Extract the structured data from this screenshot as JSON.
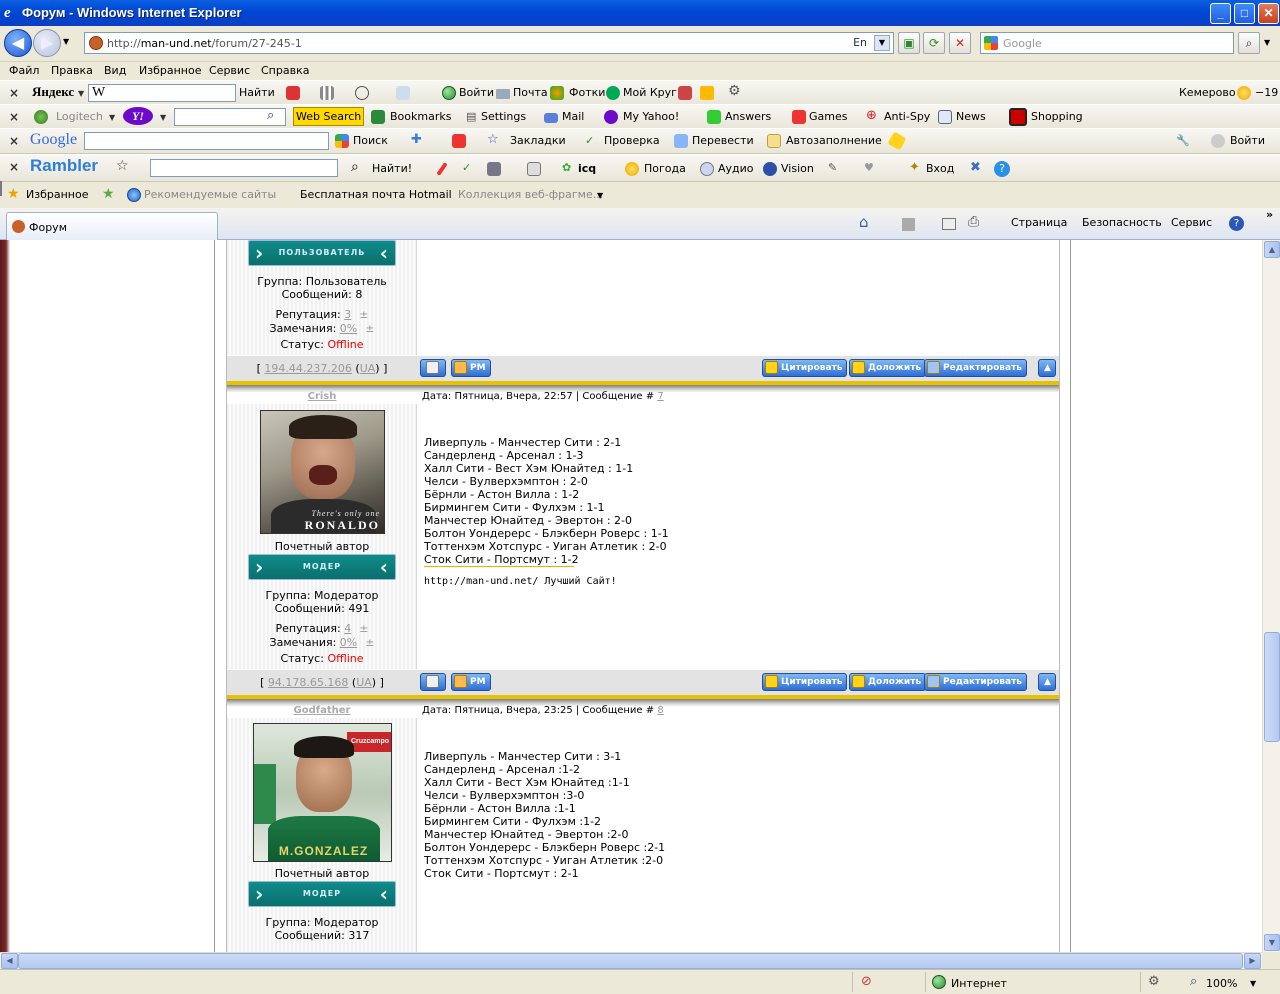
{
  "window": {
    "title": "Форум - Windows Internet Explorer",
    "minimize": "_",
    "maximize": "□",
    "close": "✕"
  },
  "address": {
    "url_prefix": "http://",
    "url_host": "man-und.net",
    "url_path": "/forum/27-245-1",
    "lang": "En",
    "search_placeholder": "Google"
  },
  "menu": [
    "Файл",
    "Правка",
    "Вид",
    "Избранное",
    "Сервис",
    "Справка"
  ],
  "yandex_bar": {
    "logo": "Яндекс",
    "input_value": "W",
    "find": "Найти",
    "items": [
      "Войти",
      "Почта",
      "Фотки",
      "Мой Круг"
    ],
    "city": "Кемерово",
    "temp": "−19"
  },
  "yahoo_bar": {
    "logitech": "Logitech",
    "yahoo_logo": "Y!",
    "web_search": "Web Search",
    "items": [
      "Bookmarks",
      "Settings",
      "Mail",
      "My Yahoo!",
      "Answers",
      "Games",
      "Anti-Spy",
      "News",
      "Shopping"
    ]
  },
  "google_bar": {
    "logo": "Google",
    "items": [
      "Поиск",
      "Закладки",
      "Проверка",
      "Перевести",
      "Автозаполнение"
    ],
    "login": "Войти"
  },
  "rambler_bar": {
    "logo": "Rambler",
    "find": "Найти!",
    "items": [
      "icq",
      "Погода",
      "Аудио",
      "Vision",
      "Вход"
    ]
  },
  "favorites_bar": {
    "favorites": "Избранное",
    "items": [
      "Рекомендуемые сайты",
      "Бесплатная почта Hotmail",
      "Коллекция веб-фрагме..."
    ]
  },
  "tab": {
    "title": "Форум"
  },
  "command_bar": [
    "Страница",
    "Безопасность",
    "Сервис"
  ],
  "posts": [
    {
      "nick": "",
      "badge": "ПОЛЬЗОВАТЕЛЬ",
      "group": "Группа: Пользователь",
      "messages": "Сообщений: 8",
      "reputation_label": "Репутация:",
      "reputation": "3",
      "remarks_label": "Замечания:",
      "remarks": "0%",
      "pm": "±",
      "status_label": "Статус:",
      "status": "Offline",
      "ip": "194.44.237.206",
      "country": "UA"
    },
    {
      "nick": "Crish",
      "date": "Дата: Пятница, Вчера, 22:57 | Сообщение #",
      "msg_no": "7",
      "title": "Почетный автор",
      "badge": "МОДЕР",
      "group": "Группа: Модератор",
      "messages": "Сообщений: 491",
      "reputation_label": "Репутация:",
      "reputation": "4",
      "remarks_label": "Замечания:",
      "remarks": "0%",
      "pm": "±",
      "status_label": "Статус:",
      "status": "Offline",
      "ip": "94.178.65.168",
      "country": "UA",
      "avatar_text": "There's only one",
      "avatar_name": "RONALDO",
      "lines": [
        "Ливерпуль - Манчестер Сити : 2-1",
        "Сандерленд - Арсенал : 1-3",
        "Халл Сити - Вест Хэм Юнайтед : 1-1",
        "Челси - Вулверхэмптон : 2-0",
        "Бёрнли - Астон Вилла : 1-2",
        "Бирмингем Сити - Фулхэм : 1-1",
        "Манчестер Юнайтед - Эвертон : 2-0",
        "Болтон Уондерерс - Блэкберн Роверс : 1-1",
        "Тоттенхэм Хотспурс - Уиган Атлетик : 2-0",
        "Сток Сити - Портсмут : 1-2"
      ],
      "signature": "http://man-und.net/ Лучший Сайт!"
    },
    {
      "nick": "Godfather",
      "date": "Дата: Пятница, Вчера, 23:25 | Сообщение #",
      "msg_no": "8",
      "title": "Почетный автор",
      "badge": "МОДЕР",
      "group": "Группа: Модератор",
      "messages": "Сообщений: 317",
      "avatar_text": "Cruzcampo",
      "avatar_name": "M.GONZALEZ",
      "lines": [
        "Ливерпуль - Манчестер Сити : 3-1",
        "Сандерленд - Арсенал :1-2",
        "Халл Сити - Вест Хэм Юнайтед :1-1",
        "Челси - Вулверхэмптон :3-0",
        "Бёрнли - Астон Вилла :1-1",
        "Бирмингем Сити - Фулхэм :1-2",
        "Манчестер Юнайтед - Эвертон :2-0",
        "Болтон Уондерерс - Блэкберн Роверс :2-1",
        "Тоттенхэм Хотспурс - Уиган Атлетик :2-0",
        "Сток Сити - Портсмут : 2-1"
      ]
    }
  ],
  "post_buttons": {
    "pm": "PM",
    "quote": "Цитировать",
    "report": "Доложить",
    "edit": "Редактировать"
  },
  "status": {
    "zone": "Интернет",
    "zoom": "100%"
  }
}
